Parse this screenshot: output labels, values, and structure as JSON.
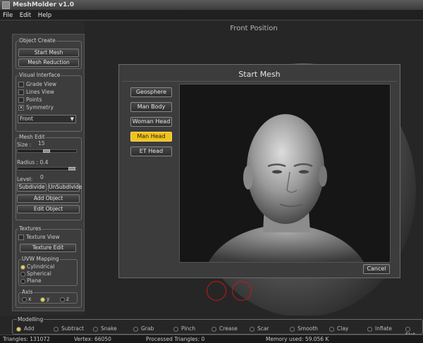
{
  "app": {
    "title": "MeshMolder v1.0"
  },
  "menu": [
    "File",
    "Edit",
    "Help"
  ],
  "viewport": {
    "title": "Front Position"
  },
  "panel": {
    "object_create": {
      "title": "Object Create",
      "start_mesh": "Start Mesh",
      "mesh_reduction": "Mesh Reduction"
    },
    "visual_interface": {
      "title": "Visual Interface",
      "options": [
        {
          "label": "Grade View",
          "checked": false
        },
        {
          "label": "Lines View",
          "checked": false
        },
        {
          "label": "Points",
          "checked": false
        },
        {
          "label": "Symmetry",
          "checked": true
        }
      ],
      "view_select": "Front"
    },
    "mesh_edit": {
      "title": "Mesh Edit",
      "size_label": "Size :",
      "size_value": "15",
      "size_level": 0.45,
      "radius_label": "Radius : 0.4",
      "radius_level": 0.9,
      "level_label": "Level:",
      "level_value": "0",
      "subdivide": "Subdivide",
      "unsubdivide": "UnSubdivide",
      "add_object": "Add Object",
      "edit_object": "Edit Object"
    },
    "textures": {
      "title": "Textures",
      "texture_view": "Texture View",
      "texture_edit": "Texture Edit",
      "uvw": {
        "title": "UVW Mapping",
        "options": [
          {
            "label": "Cylindrical",
            "selected": true
          },
          {
            "label": "Spherical",
            "selected": false
          },
          {
            "label": "Plane",
            "selected": false
          }
        ]
      },
      "axis": {
        "title": "Axis",
        "options": [
          {
            "label": "x",
            "selected": false
          },
          {
            "label": "y",
            "selected": true
          },
          {
            "label": "z",
            "selected": false
          }
        ]
      }
    }
  },
  "dialog": {
    "title": "Start Mesh",
    "options": [
      "Geosphere",
      "Man Body",
      "Woman Head",
      "Man Head",
      "ET Head"
    ],
    "selected": "Man Head",
    "cancel": "Cancel"
  },
  "modelling": {
    "title": "Modelling",
    "tools": [
      {
        "label": "Add",
        "selected": true
      },
      {
        "label": "Subtract",
        "selected": false
      },
      {
        "label": "Snake",
        "selected": false
      },
      {
        "label": "Grab",
        "selected": false
      },
      {
        "label": "Pinch",
        "selected": false
      },
      {
        "label": "Crease",
        "selected": false
      },
      {
        "label": "Scar",
        "selected": false
      },
      {
        "label": "Smooth",
        "selected": false
      },
      {
        "label": "Clay",
        "selected": false
      },
      {
        "label": "Inflate",
        "selected": false
      },
      {
        "label": "Flat",
        "selected": false
      }
    ]
  },
  "status": {
    "triangles": "Triangles: 131072",
    "vertex": "Vertex: 66050",
    "processed": "Processed Triangles: 0",
    "memory": "Memory used: 59.056 K"
  },
  "colors": {
    "accent": "#f2c318",
    "marker": "#c81818"
  }
}
